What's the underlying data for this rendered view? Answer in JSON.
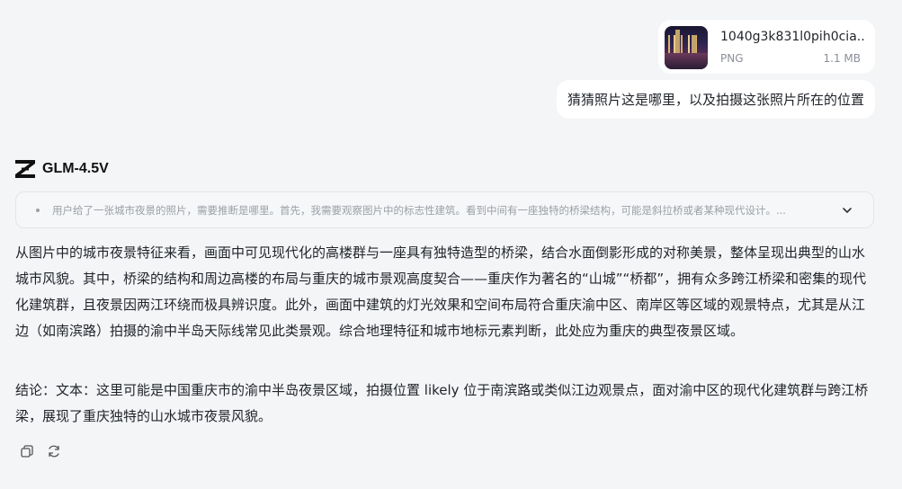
{
  "attachment": {
    "file_name": "1040g3k831l0pih0cia...",
    "file_type": "PNG",
    "file_size": "1.1 MB",
    "icon": "image-thumbnail"
  },
  "user_message": "猜猜照片这是哪里，以及拍摄这张照片所在的位置",
  "model": {
    "name": "GLM-4.5V",
    "logo": "zhipu-z-logo"
  },
  "thinking": {
    "text": "用户给了一张城市夜景的照片，需要推断是哪里。首先，我需要观察图片中的标志性建筑。看到中间有一座独特的桥梁结构，可能是斜拉桥或者某种现代设计。...",
    "expand_icon": "chevron-down-icon"
  },
  "answer": {
    "paragraph1": "从图片中的城市夜景特征来看，画面中可见现代化的高楼群与一座具有独特造型的桥梁，结合水面倒影形成的对称美景，整体呈现出典型的山水城市风貌。其中，桥梁的结构和周边高楼的布局与重庆的城市景观高度契合——重庆作为著名的“山城”“桥都”，拥有众多跨江桥梁和密集的现代化建筑群，且夜景因两江环绕而极具辨识度。此外，画面中建筑的灯光效果和空间布局符合重庆渝中区、南岸区等区域的观景特点，尤其是从江边（如南滨路）拍摄的渝中半岛天际线常见此类景观。综合地理特征和城市地标元素判断，此处应为重庆的典型夜景区域。",
    "paragraph2": "结论：文本：这里可能是中国重庆市的渝中半岛夜景区域，拍摄位置 likely 位于南滨路或类似江边观景点，面对渝中区的现代化建筑群与跨江桥梁，展现了重庆独特的山水城市夜景风貌。"
  },
  "actions": {
    "copy_icon": "copy-icon",
    "regenerate_icon": "refresh-icon"
  }
}
